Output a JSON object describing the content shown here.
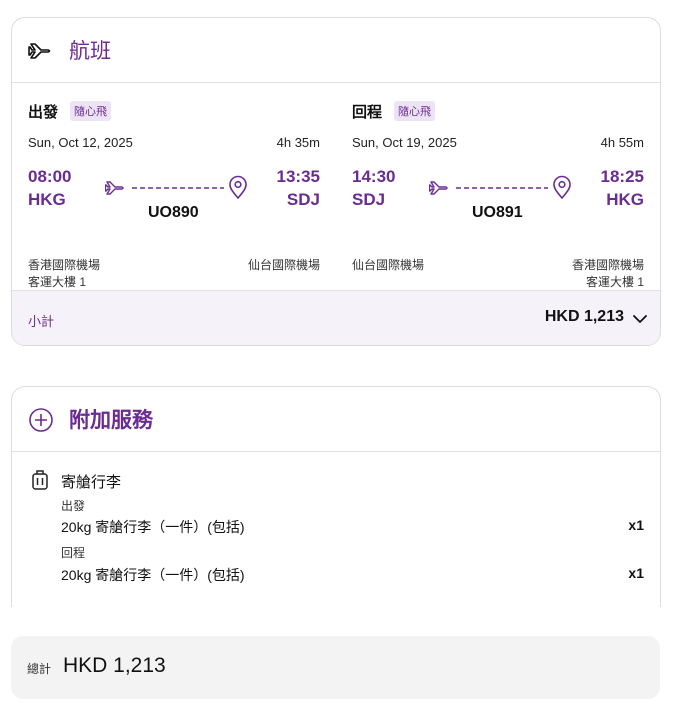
{
  "flight_section": {
    "title": "航班",
    "outbound": {
      "label": "出發",
      "badge": "隨心飛",
      "date": "Sun, Oct 12, 2025",
      "duration": "4h 35m",
      "dep_time": "08:00",
      "dep_code": "HKG",
      "arr_time": "13:35",
      "arr_code": "SDJ",
      "flight_no": "UO890",
      "dep_airport": "香港國際機場",
      "dep_terminal": "客運大樓 1",
      "arr_airport": "仙台國際機場"
    },
    "return": {
      "label": "回程",
      "badge": "隨心飛",
      "date": "Sun, Oct 19, 2025",
      "duration": "4h 55m",
      "dep_time": "14:30",
      "dep_code": "SDJ",
      "arr_time": "18:25",
      "arr_code": "HKG",
      "flight_no": "UO891",
      "dep_airport": "仙台國際機場",
      "arr_airport": "香港國際機場",
      "arr_terminal": "客運大樓 1"
    },
    "subtotal_label": "小計",
    "subtotal_amount": "HKD 1,213"
  },
  "addons_section": {
    "title": "附加服務",
    "baggage": {
      "title": "寄艙行李",
      "outbound_label": "出發",
      "outbound_item": "20kg 寄艙行李（一件）(包括)",
      "outbound_qty": "x1",
      "return_label": "回程",
      "return_item": "20kg 寄艙行李（一件）(包括)",
      "return_qty": "x1"
    }
  },
  "total": {
    "label": "總計",
    "amount": "HKD 1,213"
  },
  "colors": {
    "accent": "#6b2c91",
    "badge_bg": "#ece3f4",
    "subtotal_bg": "#f5f2f9",
    "total_bg": "#f3f3f4"
  }
}
